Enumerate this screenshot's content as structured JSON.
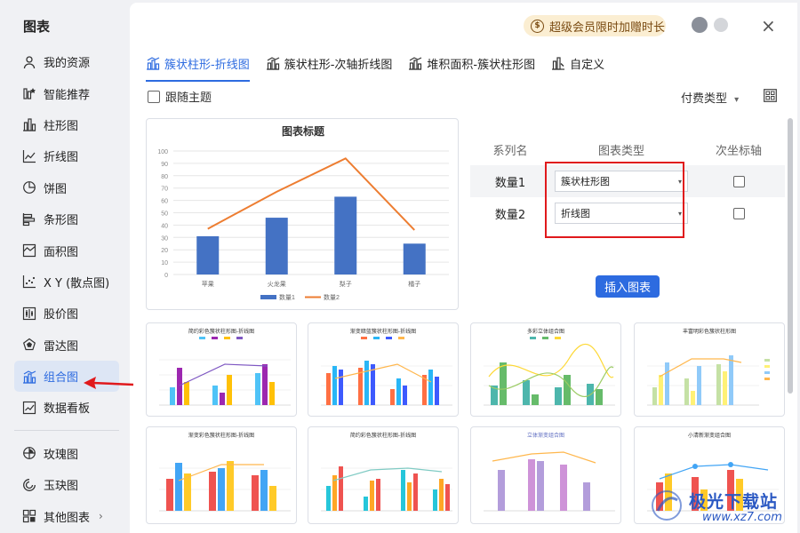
{
  "app": {
    "title": "图表"
  },
  "sidebar": {
    "items": [
      {
        "label": "我的资源",
        "icon": "person-icon"
      },
      {
        "label": "智能推荐",
        "icon": "bulb-icon"
      },
      {
        "label": "柱形图",
        "icon": "column-chart-icon"
      },
      {
        "label": "折线图",
        "icon": "line-chart-icon"
      },
      {
        "label": "饼图",
        "icon": "pie-chart-icon"
      },
      {
        "label": "条形图",
        "icon": "bar-chart-icon"
      },
      {
        "label": "面积图",
        "icon": "area-chart-icon"
      },
      {
        "label": "X Y (散点图)",
        "icon": "scatter-chart-icon"
      },
      {
        "label": "股价图",
        "icon": "stock-chart-icon"
      },
      {
        "label": "雷达图",
        "icon": "radar-chart-icon"
      },
      {
        "label": "组合图",
        "icon": "combo-chart-icon",
        "active": true
      },
      {
        "label": "数据看板",
        "icon": "dashboard-icon"
      }
    ],
    "extra": [
      {
        "label": "玫瑰图",
        "icon": "rose-chart-icon"
      },
      {
        "label": "玉玦图",
        "icon": "ring-chart-icon"
      },
      {
        "label": "其他图表",
        "icon": "more-charts-icon"
      }
    ],
    "more_arrow": "›"
  },
  "header": {
    "vip_label": "超级会员限时加赠时长",
    "vip_coin": "$",
    "close": "×"
  },
  "tabs": [
    {
      "label": "簇状柱形-折线图",
      "active": true
    },
    {
      "label": "簇状柱形-次轴折线图"
    },
    {
      "label": "堆积面积-簇状柱形图"
    },
    {
      "label": "自定义"
    }
  ],
  "options": {
    "follow_theme": "跟随主题",
    "pay_type": "付费类型",
    "pay_arrow": "▾"
  },
  "preview": {
    "chart_data": {
      "type": "bar+line",
      "title": "图表标题",
      "categories": [
        "苹果",
        "火龙果",
        "梨子",
        "橘子"
      ],
      "series": [
        {
          "name": "数量1",
          "type": "bar",
          "color": "#4472c4",
          "values": [
            31,
            46,
            63,
            25
          ]
        },
        {
          "name": "数量2",
          "type": "line",
          "color": "#ed7d31",
          "values": [
            37,
            67,
            94,
            36
          ]
        }
      ],
      "ylim": [
        0,
        100
      ],
      "yticks": [
        "0",
        "10",
        "20",
        "30",
        "40",
        "50",
        "60",
        "70",
        "80",
        "90",
        "100"
      ]
    }
  },
  "series_table": {
    "headers": [
      "系列名",
      "图表类型",
      "次坐标轴"
    ],
    "rows": [
      {
        "name": "数量1",
        "type": "簇状柱形图",
        "secondary": false
      },
      {
        "name": "数量2",
        "type": "折线图",
        "secondary": false
      }
    ],
    "arrow": "▾",
    "insert_label": "插入图表"
  },
  "templates": [
    {
      "title": "简约彩色簇状柱形图-折线图"
    },
    {
      "title": "渐变暗蓝簇状柱形图-折线图"
    },
    {
      "title": "多彩立体组合图"
    },
    {
      "title": "丰富明彩色簇状柱形图"
    },
    {
      "title": "渐变彩色簇状柱形图-折线图"
    },
    {
      "title": "简约彩色簇状柱形图-折线图"
    },
    {
      "title": "立体渐变组合图"
    },
    {
      "title": "小清新渐变组合图"
    }
  ],
  "watermark": {
    "brand": "极光下载站",
    "url": "www.xz7.com"
  }
}
